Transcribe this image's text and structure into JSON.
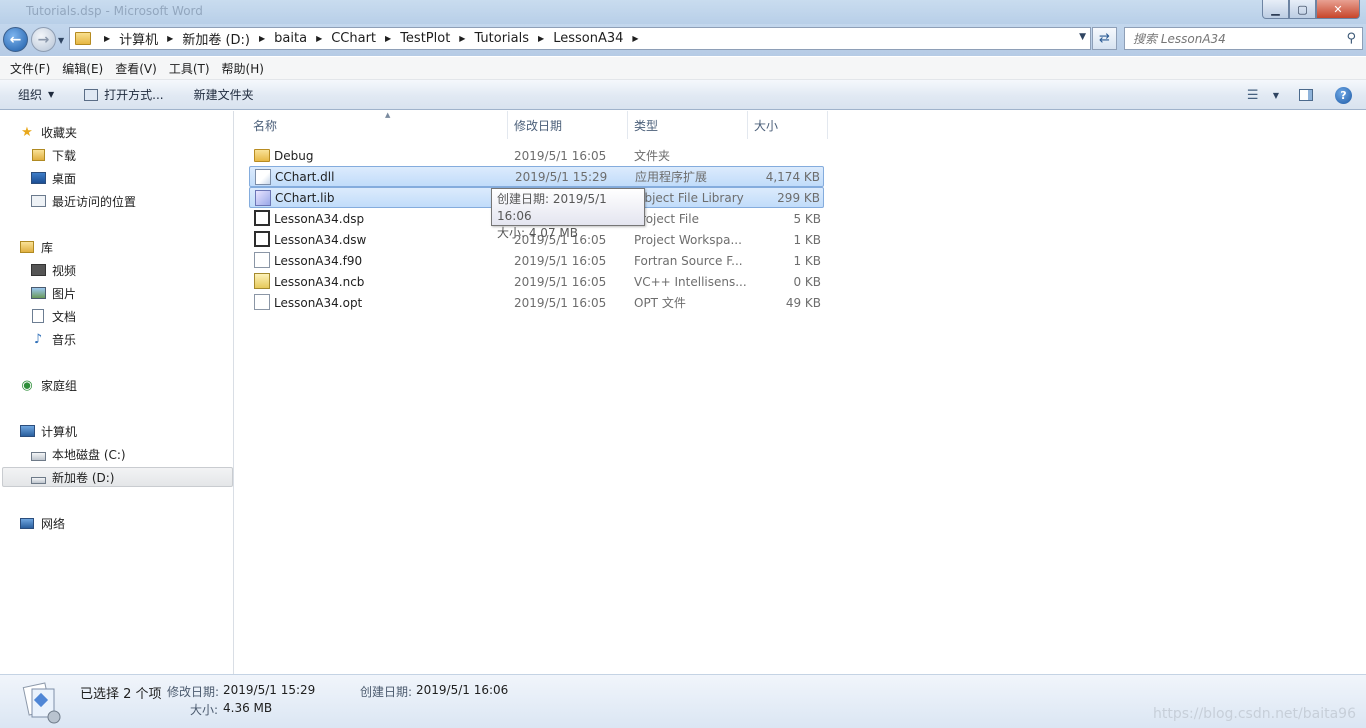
{
  "window": {
    "title": "Tutorials.dsp - Microsoft Word"
  },
  "address": {
    "crumbs": [
      "计算机",
      "新加卷 (D:)",
      "baita",
      "CChart",
      "TestPlot",
      "Tutorials",
      "LessonA34"
    ],
    "search_placeholder": "搜索 LessonA34"
  },
  "menu": [
    "文件(F)",
    "编辑(E)",
    "查看(V)",
    "工具(T)",
    "帮助(H)"
  ],
  "toolbar": {
    "organize": "组织",
    "open_with": "打开方式...",
    "new_folder": "新建文件夹"
  },
  "nav": {
    "favorites": "收藏夹",
    "fav_items": [
      "下载",
      "桌面",
      "最近访问的位置"
    ],
    "libraries": "库",
    "lib_items": [
      "视频",
      "图片",
      "文档",
      "音乐"
    ],
    "homegroup": "家庭组",
    "computer": "计算机",
    "comp_items": [
      "本地磁盘 (C:)",
      "新加卷 (D:)"
    ],
    "network": "网络"
  },
  "columns": {
    "name": "名称",
    "date": "修改日期",
    "type": "类型",
    "size": "大小"
  },
  "files": [
    {
      "name": "Debug",
      "date": "2019/5/1 16:05",
      "type": "文件夹",
      "size": "",
      "icon": "folder-icon",
      "selected": false
    },
    {
      "name": "CChart.dll",
      "date": "2019/5/1 15:29",
      "type": "应用程序扩展",
      "size": "4,174 KB",
      "icon": "dll-icon",
      "selected": true
    },
    {
      "name": "CChart.lib",
      "date": "",
      "type": "Object File Library",
      "size": "299 KB",
      "icon": "lib-icon",
      "selected": true
    },
    {
      "name": "LessonA34.dsp",
      "date": "",
      "type": "Project File",
      "size": "5 KB",
      "icon": "project-icon",
      "selected": false
    },
    {
      "name": "LessonA34.dsw",
      "date": "2019/5/1 16:05",
      "type": "Project Workspa...",
      "size": "1 KB",
      "icon": "workspace-icon",
      "selected": false
    },
    {
      "name": "LessonA34.f90",
      "date": "2019/5/1 16:05",
      "type": "Fortran Source F...",
      "size": "1 KB",
      "icon": "fortran-icon",
      "selected": false
    },
    {
      "name": "LessonA34.ncb",
      "date": "2019/5/1 16:05",
      "type": "VC++ Intellisens...",
      "size": "0 KB",
      "icon": "ncb-icon",
      "selected": false
    },
    {
      "name": "LessonA34.opt",
      "date": "2019/5/1 16:05",
      "type": "OPT 文件",
      "size": "49 KB",
      "icon": "file-icon",
      "selected": false
    }
  ],
  "tooltip": {
    "line1": "创建日期: 2019/5/1 16:06",
    "line2": "大小: 4.07 MB"
  },
  "details": {
    "selected": "已选择 2 个项",
    "modified_label": "修改日期:",
    "modified_value": "2019/5/1 15:29",
    "created_label": "创建日期:",
    "created_value": "2019/5/1 16:06",
    "size_label": "大小:",
    "size_value": "4.36 MB"
  },
  "watermark": "https://blog.csdn.net/baita96"
}
